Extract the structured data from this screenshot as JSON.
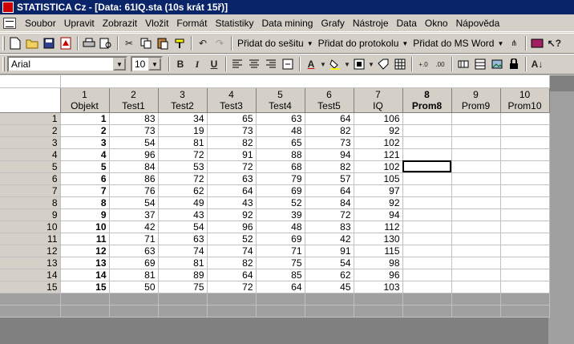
{
  "window": {
    "title": "STATISTICA Cz - [Data: 61IQ.sta (10s krát 15ř)]"
  },
  "menu": {
    "items": [
      {
        "label": "Soubor"
      },
      {
        "label": "Upravit"
      },
      {
        "label": "Zobrazit"
      },
      {
        "label": "Vložit"
      },
      {
        "label": "Formát"
      },
      {
        "label": "Statistiky"
      },
      {
        "label": "Data mining"
      },
      {
        "label": "Grafy"
      },
      {
        "label": "Nástroje"
      },
      {
        "label": "Data"
      },
      {
        "label": "Okno"
      },
      {
        "label": "Nápověda"
      }
    ]
  },
  "toolbar": {
    "add_to_workbook": "Přidat do sešitu",
    "add_to_report": "Přidat do protokolu",
    "add_to_word": "Přidat do MS Word"
  },
  "format_bar": {
    "font": "Arial",
    "size": "10",
    "bold": "B",
    "italic": "I",
    "underline": "U"
  },
  "spreadsheet": {
    "columns": [
      {
        "num": "1",
        "name": "Objekt",
        "bold": false
      },
      {
        "num": "2",
        "name": "Test1",
        "bold": false
      },
      {
        "num": "3",
        "name": "Test2",
        "bold": false
      },
      {
        "num": "4",
        "name": "Test3",
        "bold": false
      },
      {
        "num": "5",
        "name": "Test4",
        "bold": false
      },
      {
        "num": "6",
        "name": "Test5",
        "bold": false
      },
      {
        "num": "7",
        "name": "IQ",
        "bold": false
      },
      {
        "num": "8",
        "name": "Prom8",
        "bold": true
      },
      {
        "num": "9",
        "name": "Prom9",
        "bold": false
      },
      {
        "num": "10",
        "name": "Prom10",
        "bold": false
      }
    ],
    "rows": [
      {
        "n": "1",
        "v": [
          "1",
          "83",
          "34",
          "65",
          "63",
          "64",
          "106"
        ]
      },
      {
        "n": "2",
        "v": [
          "2",
          "73",
          "19",
          "73",
          "48",
          "82",
          "92"
        ]
      },
      {
        "n": "3",
        "v": [
          "3",
          "54",
          "81",
          "82",
          "65",
          "73",
          "102"
        ]
      },
      {
        "n": "4",
        "v": [
          "4",
          "96",
          "72",
          "91",
          "88",
          "94",
          "121"
        ]
      },
      {
        "n": "5",
        "v": [
          "5",
          "84",
          "53",
          "72",
          "68",
          "82",
          "102"
        ]
      },
      {
        "n": "6",
        "v": [
          "6",
          "86",
          "72",
          "63",
          "79",
          "57",
          "105"
        ]
      },
      {
        "n": "7",
        "v": [
          "7",
          "76",
          "62",
          "64",
          "69",
          "64",
          "97"
        ]
      },
      {
        "n": "8",
        "v": [
          "8",
          "54",
          "49",
          "43",
          "52",
          "84",
          "92"
        ]
      },
      {
        "n": "9",
        "v": [
          "9",
          "37",
          "43",
          "92",
          "39",
          "72",
          "94"
        ]
      },
      {
        "n": "10",
        "v": [
          "10",
          "42",
          "54",
          "96",
          "48",
          "83",
          "112"
        ]
      },
      {
        "n": "11",
        "v": [
          "11",
          "71",
          "63",
          "52",
          "69",
          "42",
          "130"
        ]
      },
      {
        "n": "12",
        "v": [
          "12",
          "63",
          "74",
          "74",
          "71",
          "91",
          "115"
        ]
      },
      {
        "n": "13",
        "v": [
          "13",
          "69",
          "81",
          "82",
          "75",
          "54",
          "98"
        ]
      },
      {
        "n": "14",
        "v": [
          "14",
          "81",
          "89",
          "64",
          "85",
          "62",
          "96"
        ]
      },
      {
        "n": "15",
        "v": [
          "15",
          "50",
          "75",
          "72",
          "64",
          "45",
          "103"
        ]
      }
    ],
    "active_cell": {
      "row": 5,
      "col": 8
    }
  },
  "colors": {
    "titlebar": "#0a246a",
    "chrome": "#d4d0c8"
  }
}
